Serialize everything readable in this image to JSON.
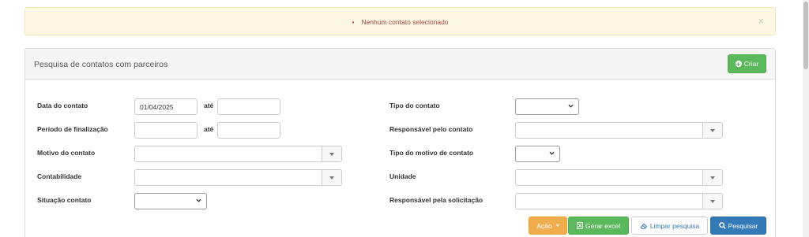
{
  "alert": {
    "bullet": "•",
    "message": "Nenhum contato selecionado",
    "close": "×"
  },
  "panel": {
    "title": "Pesquisa de contatos com parceiros",
    "create_label": "Criar"
  },
  "form": {
    "data_contato": {
      "label": "Data do contato",
      "from_value": "01/04/2025",
      "to_value": "",
      "until_label": "até"
    },
    "periodo_finalizacao": {
      "label": "Período de finalização",
      "from_value": "",
      "to_value": "",
      "until_label": "até"
    },
    "motivo_contato": {
      "label": "Motivo do contato",
      "value": ""
    },
    "contabilidade": {
      "label": "Contabilidade",
      "value": ""
    },
    "situacao_contato": {
      "label": "Situação contato",
      "value": ""
    },
    "tipo_contato": {
      "label": "Tipo do contato",
      "value": ""
    },
    "responsavel_contato": {
      "label": "Responsável pelo contato",
      "value": ""
    },
    "tipo_motivo_contato": {
      "label": "Tipo do motivo de contato",
      "value": ""
    },
    "unidade": {
      "label": "Unidade",
      "value": ""
    },
    "responsavel_solicitacao": {
      "label": "Responsável pela solicitação",
      "value": ""
    }
  },
  "actions": {
    "acao": "Ação",
    "gerar_excel": "Gerar excel",
    "limpar": "Limpar pesquisa",
    "pesquisar": "Pesquisar"
  },
  "colors": {
    "success": "#5cb85c",
    "warning": "#f0ad4e",
    "primary": "#337ab7",
    "alert_bg": "#fcf8e3",
    "alert_text": "#a94442"
  }
}
